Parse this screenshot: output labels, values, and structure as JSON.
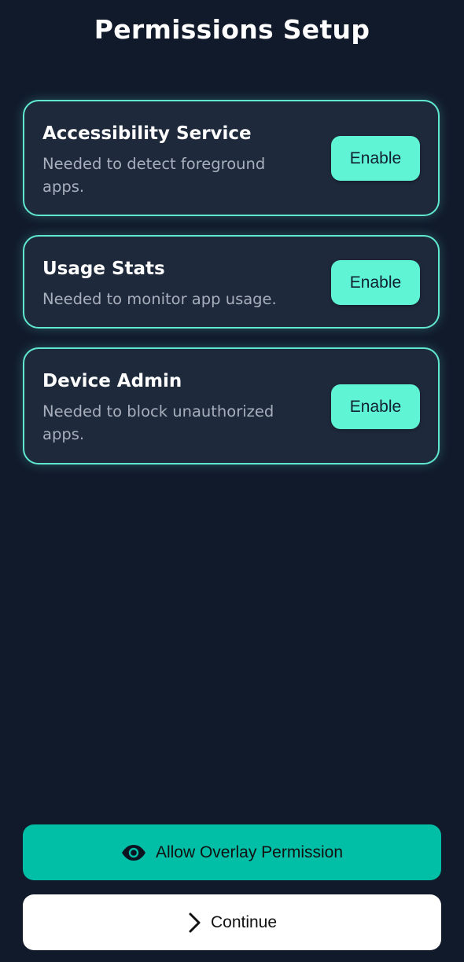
{
  "header": {
    "title": "Permissions Setup"
  },
  "permissions": [
    {
      "title": "Accessibility Service",
      "description": "Needed to detect foreground apps.",
      "button_label": "Enable"
    },
    {
      "title": "Usage Stats",
      "description": "Needed to monitor app usage.",
      "button_label": "Enable"
    },
    {
      "title": "Device Admin",
      "description": "Needed to block unauthorized apps.",
      "button_label": "Enable"
    }
  ],
  "footer": {
    "overlay_label": "Allow Overlay Permission",
    "overlay_icon": "eye-icon",
    "continue_label": "Continue",
    "continue_icon": "chevron-right-icon"
  },
  "colors": {
    "background": "#111a2b",
    "card_background": "#1e293b",
    "card_border": "#5fe8cf",
    "enable_button": "#5ff5d4",
    "overlay_button": "#00bfa6",
    "continue_button": "#ffffff"
  }
}
